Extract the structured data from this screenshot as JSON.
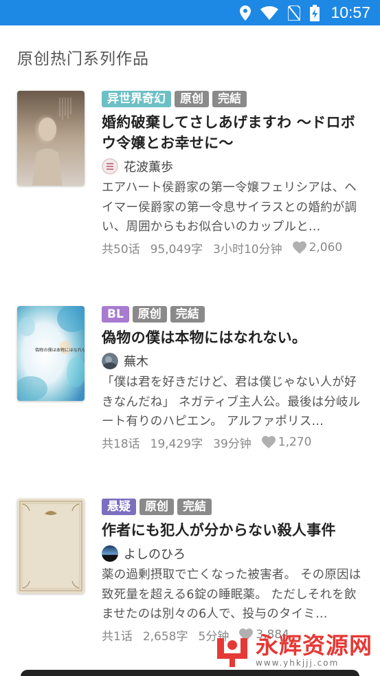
{
  "status_bar": {
    "time": "10:57",
    "icons": [
      "location-icon",
      "wifi-icon",
      "no-sim-icon",
      "battery-charging-icon"
    ]
  },
  "section": {
    "title": "原创热门系列作品"
  },
  "books": [
    {
      "tags": [
        {
          "label": "异世界奇幻",
          "color": "#6cc0c5"
        },
        {
          "label": "原创",
          "color": "#8a8a8a"
        },
        {
          "label": "完結",
          "color": "#8a8a8a"
        }
      ],
      "title": "婚約破棄してさしあげますわ 〜ドロボウ令嬢とお幸せに〜",
      "author": "花波薫歩",
      "summary": "エアハート侯爵家の第一令嬢フェリシアは、ヘイマー侯爵家の第一令息サイラスとの婚約が調い、周囲からもお似合いのカップルと…",
      "chapters": "共50话",
      "words": "95,049字",
      "read_time": "3小时10分钟",
      "likes": "2,060"
    },
    {
      "tags": [
        {
          "label": "BL",
          "color": "#a77bcf"
        },
        {
          "label": "原创",
          "color": "#8a8a8a"
        },
        {
          "label": "完結",
          "color": "#8a8a8a"
        }
      ],
      "title": "偽物の僕は本物にはなれない。",
      "cover_text": "偽物の僕は本物にはなれない。",
      "author": "蕪木",
      "summary": "「僕は君を好きだけど、君は僕じゃない人が好きなんだね」 ネガティブ主人公。最後は分岐ルート有りのハピエン。 アルファポリス…",
      "chapters": "共18话",
      "words": "19,429字",
      "read_time": "39分钟",
      "likes": "1,270"
    },
    {
      "tags": [
        {
          "label": "悬疑",
          "color": "#7c6fbf"
        },
        {
          "label": "原创",
          "color": "#8a8a8a"
        },
        {
          "label": "完結",
          "color": "#8a8a8a"
        }
      ],
      "title": "作者にも犯人が分からない殺人事件",
      "author": "よしのひろ",
      "summary": "薬の過剰摂取で亡くなった被害者。 その原因は致死量を超える6錠の睡眠薬。 ただしそれを飲ませたのは別々の6人で、投与のタイミ…",
      "chapters": "共1话",
      "words": "2,658字",
      "read_time": "5分钟",
      "likes": "3,884"
    }
  ],
  "watermark": {
    "main": "永辉资源网",
    "url": "www.yhkjjj.com"
  }
}
